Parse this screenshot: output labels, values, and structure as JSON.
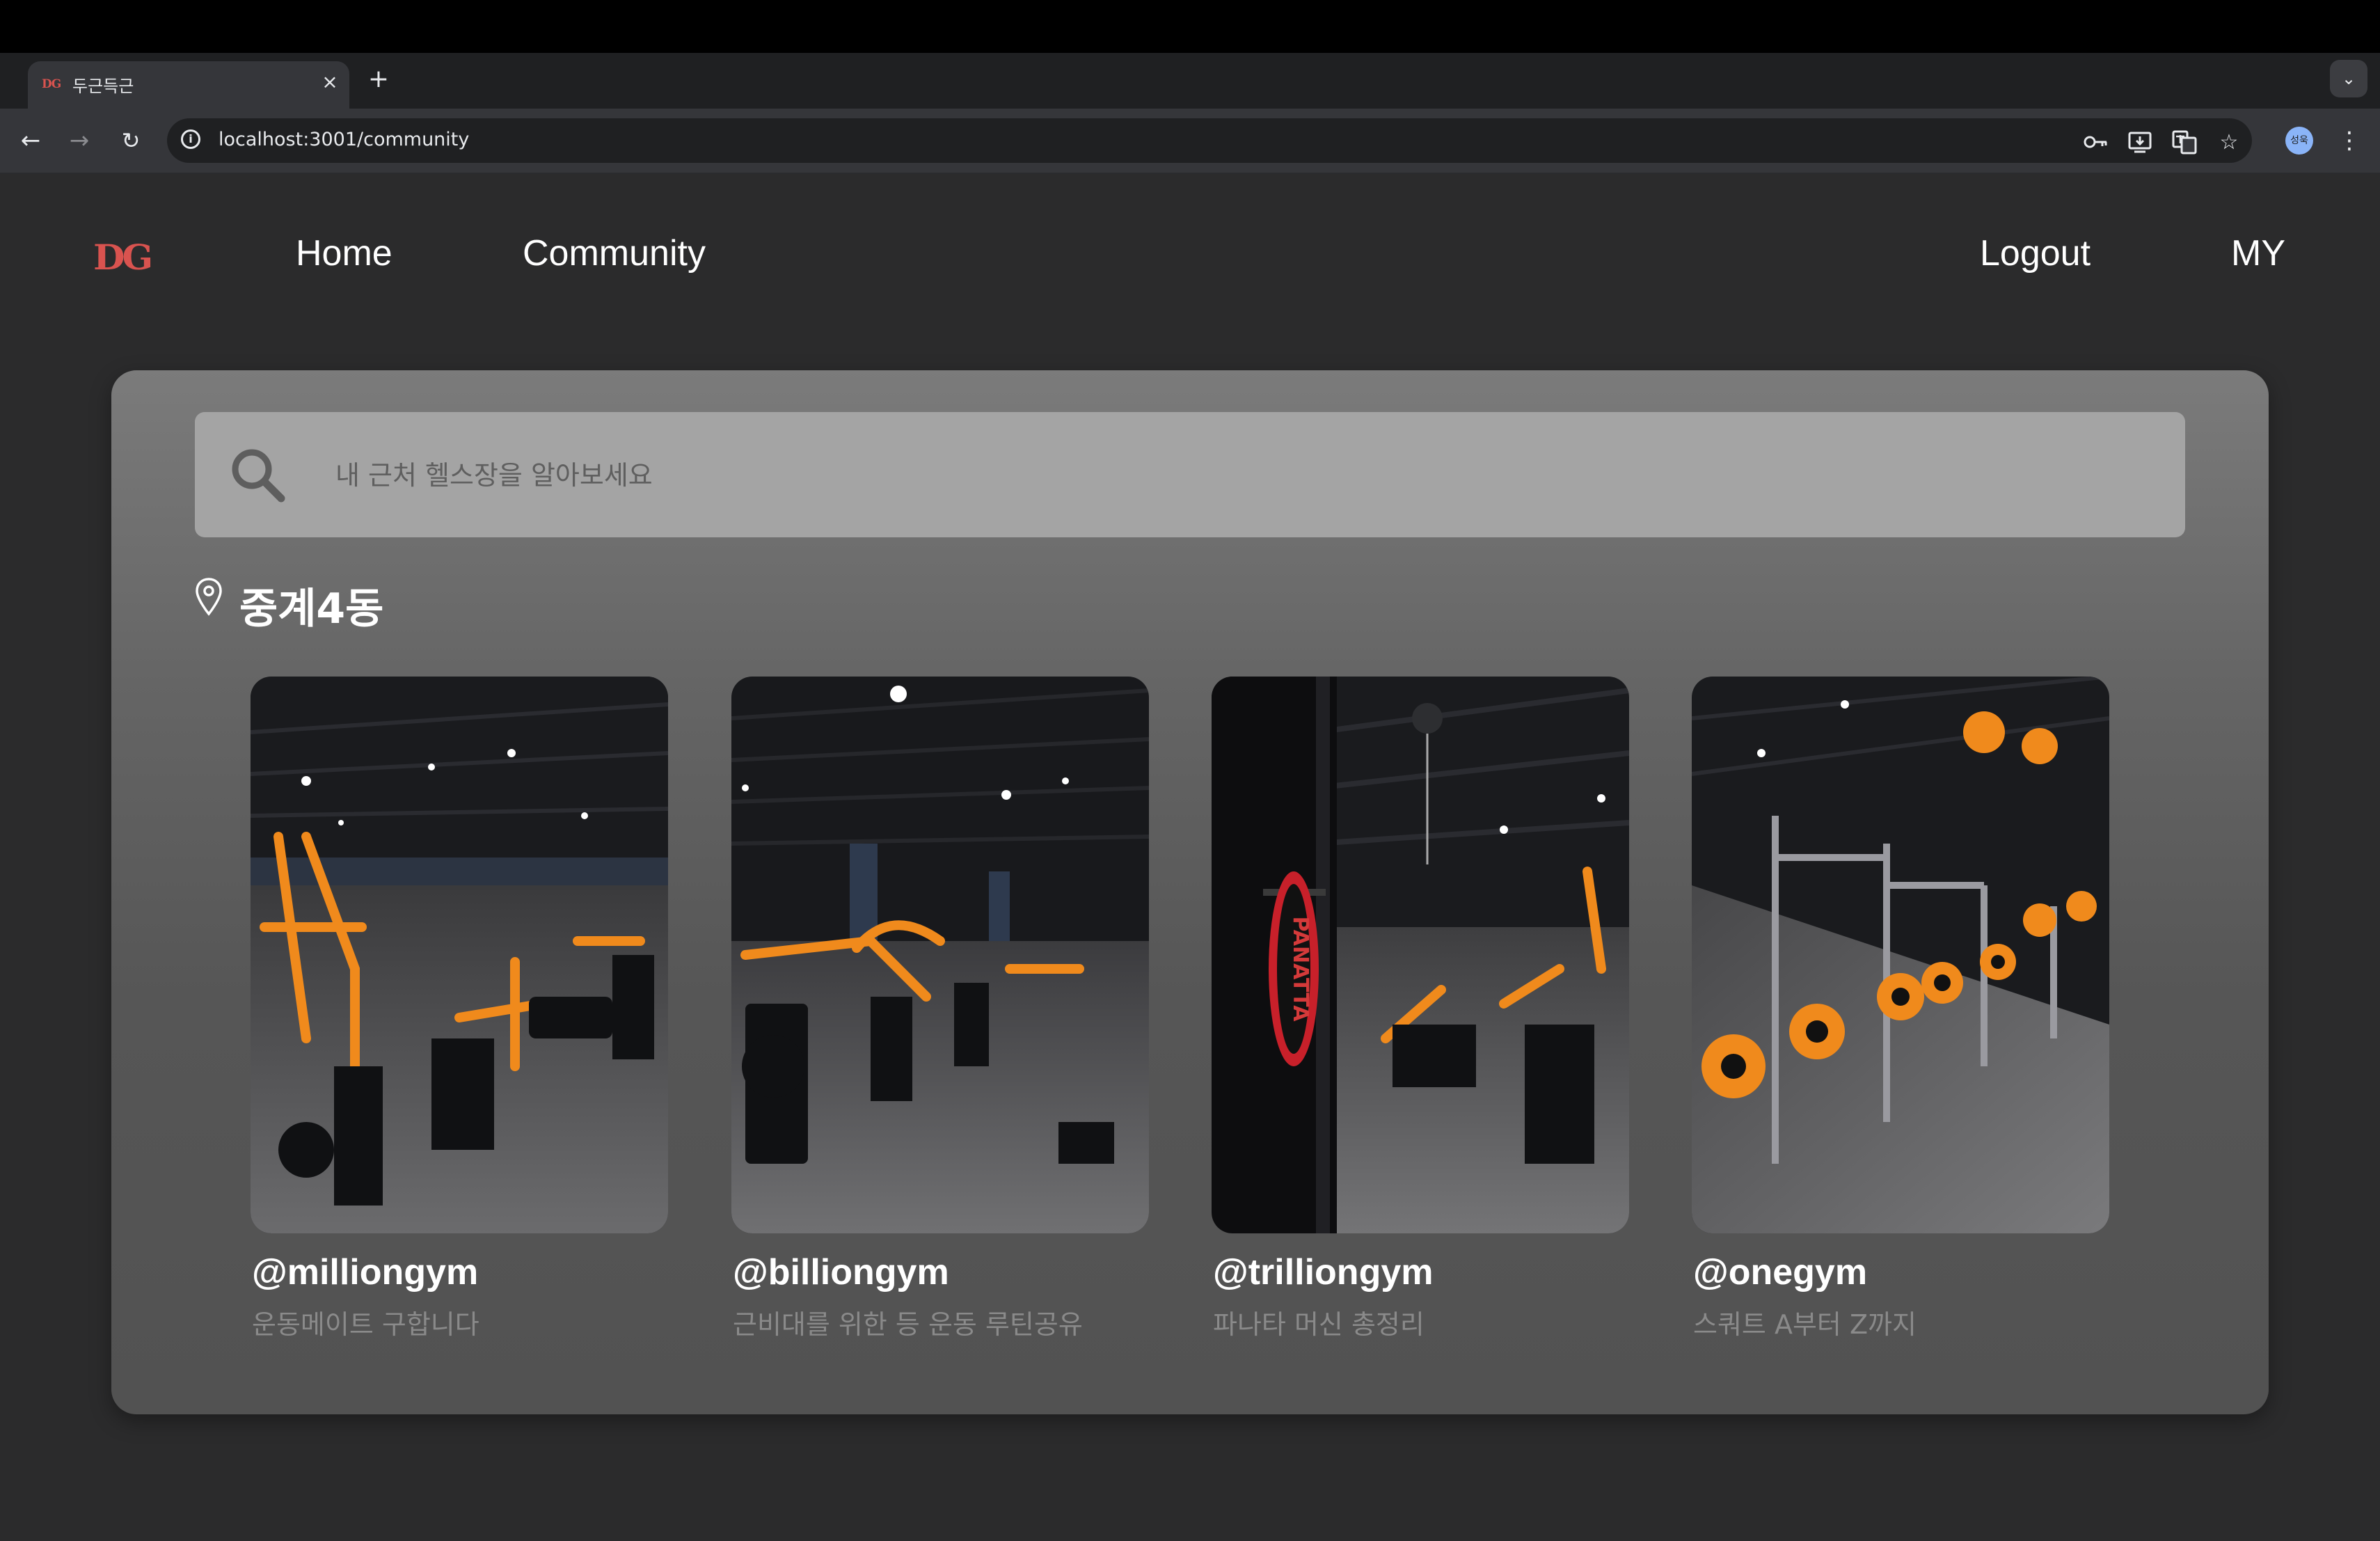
{
  "browser": {
    "tab_title": "두근득근",
    "tab_favicon": "DG",
    "tab_close": "×",
    "new_tab": "+",
    "tab_menu": "⌄",
    "url": "localhost:3001/community",
    "profile_chip": "성욱"
  },
  "nav": {
    "logo": "DG",
    "logo_color": "#d9534f",
    "home": "Home",
    "community": "Community",
    "logout": "Logout",
    "my": "MY"
  },
  "search": {
    "placeholder": "내 근처 헬스장을 알아보세요"
  },
  "location": {
    "label": "중계4동"
  },
  "posts": [
    {
      "handle": "@milliongym",
      "desc": "운동메이트 구합니다"
    },
    {
      "handle": "@billiongym",
      "desc": "근비대를 위한 등 운동 루틴공유"
    },
    {
      "handle": "@trilliongym",
      "desc": "파나타 머신 총정리"
    },
    {
      "handle": "@onegym",
      "desc": "스쿼트 A부터 Z까지"
    }
  ],
  "photo_brand_text": "PANATTA"
}
